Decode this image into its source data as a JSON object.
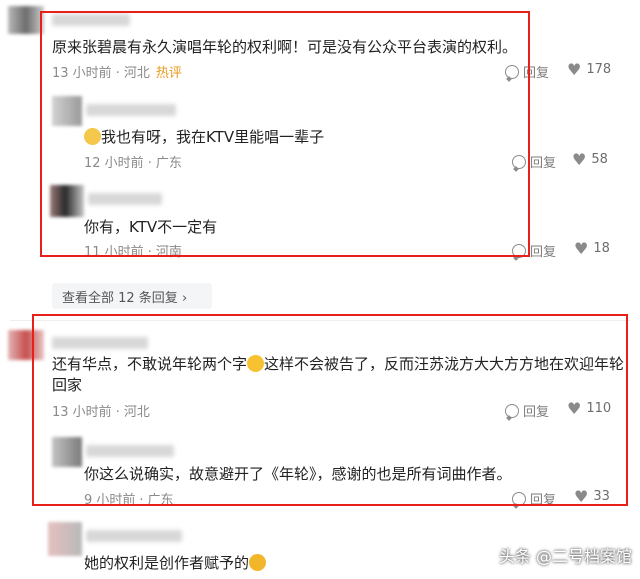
{
  "comments": [
    {
      "text": "原来张碧晨有永久演唱年轮的权利啊！可是没有公众平台表演的权利。",
      "time": "13 小时前",
      "location": "河北",
      "badge": "热评",
      "reply_label": "回复",
      "likes": "178"
    },
    {
      "text": "我也有呀，我在KTV里能唱一辈子",
      "time": "12 小时前",
      "location": "广东",
      "reply_label": "回复",
      "likes": "58"
    },
    {
      "text": "你有，KTV不一定有",
      "time": "11 小时前",
      "location": "河南",
      "reply_label": "回复",
      "likes": "18"
    },
    {
      "line1": "还有华点，不敢说年轮两个字",
      "line1b": "这样不会被告了，反而汪苏泷方大大方方地在欢迎年轮",
      "line2": "回家",
      "time": "13 小时前",
      "location": "河北",
      "reply_label": "回复",
      "likes": "110"
    },
    {
      "text": "你这么说确实，故意避开了《年轮》，感谢的也是所有词曲作者。",
      "time": "9 小时前",
      "location": "广东",
      "reply_label": "回复",
      "likes": "33"
    },
    {
      "text": "她的权利是创作者赋予的"
    }
  ],
  "view_all": "查看全部 12 条回复 ›",
  "watermark": "头条 @二号档案馆",
  "colors": {
    "highlight_box": "#e8201a",
    "hot_badge": "#e89a1c"
  }
}
